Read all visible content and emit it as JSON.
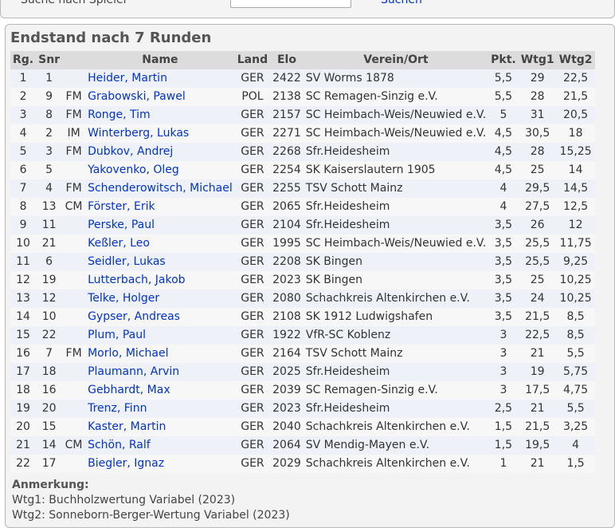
{
  "search": {
    "label": "Suche nach Spieler",
    "input_value": "",
    "button": "Suchen"
  },
  "standings": {
    "title": "Endstand nach 7 Runden",
    "headers": [
      "Rg.",
      "Snr",
      "",
      "Name",
      "Land",
      "Elo",
      "Verein/Ort",
      "Pkt.",
      "Wtg1",
      "Wtg2"
    ],
    "rows": [
      [
        "1",
        "1",
        "",
        "Heider, Martin",
        "GER",
        "2422",
        "SV Worms 1878",
        "5,5",
        "29",
        "22,5"
      ],
      [
        "2",
        "9",
        "FM",
        "Grabowski, Pawel",
        "POL",
        "2138",
        "SC Remagen-Sinzig e.V.",
        "5,5",
        "28",
        "21,5"
      ],
      [
        "3",
        "8",
        "FM",
        "Ronge, Tim",
        "GER",
        "2157",
        "SC Heimbach-Weis/Neuwied e.V.",
        "5",
        "31",
        "20,5"
      ],
      [
        "4",
        "2",
        "IM",
        "Winterberg, Lukas",
        "GER",
        "2271",
        "SC Heimbach-Weis/Neuwied e.V.",
        "4,5",
        "30,5",
        "18"
      ],
      [
        "5",
        "3",
        "FM",
        "Dubkov, Andrej",
        "GER",
        "2268",
        "Sfr.Heidesheim",
        "4,5",
        "28",
        "15,25"
      ],
      [
        "6",
        "5",
        "",
        "Yakovenko, Oleg",
        "GER",
        "2254",
        "SK Kaiserslautern 1905",
        "4,5",
        "25",
        "14"
      ],
      [
        "7",
        "4",
        "FM",
        "Schenderowitsch, Michael",
        "GER",
        "2255",
        "TSV Schott Mainz",
        "4",
        "29,5",
        "14,5"
      ],
      [
        "8",
        "13",
        "CM",
        "Förster, Erik",
        "GER",
        "2065",
        "Sfr.Heidesheim",
        "4",
        "27,5",
        "12,5"
      ],
      [
        "9",
        "11",
        "",
        "Perske, Paul",
        "GER",
        "2104",
        "Sfr.Heidesheim",
        "3,5",
        "26",
        "12"
      ],
      [
        "10",
        "21",
        "",
        "Keßler, Leo",
        "GER",
        "1995",
        "SC Heimbach-Weis/Neuwied e.V.",
        "3,5",
        "25,5",
        "11,75"
      ],
      [
        "11",
        "6",
        "",
        "Seidler, Lukas",
        "GER",
        "2208",
        "SK Bingen",
        "3,5",
        "25,5",
        "9,25"
      ],
      [
        "12",
        "19",
        "",
        "Lutterbach, Jakob",
        "GER",
        "2023",
        "SK Bingen",
        "3,5",
        "25",
        "10,25"
      ],
      [
        "13",
        "12",
        "",
        "Telke, Holger",
        "GER",
        "2080",
        "Schachkreis Altenkirchen e.V.",
        "3,5",
        "24",
        "10,25"
      ],
      [
        "14",
        "10",
        "",
        "Gypser, Andreas",
        "GER",
        "2108",
        "SK 1912 Ludwigshafen",
        "3,5",
        "21,5",
        "8,5"
      ],
      [
        "15",
        "22",
        "",
        "Plum, Paul",
        "GER",
        "1922",
        "VfR-SC Koblenz",
        "3",
        "22,5",
        "8,5"
      ],
      [
        "16",
        "7",
        "FM",
        "Morlo, Michael",
        "GER",
        "2164",
        "TSV Schott Mainz",
        "3",
        "21",
        "5,5"
      ],
      [
        "17",
        "18",
        "",
        "Plaumann, Arvin",
        "GER",
        "2025",
        "Sfr.Heidesheim",
        "3",
        "19",
        "5,75"
      ],
      [
        "18",
        "16",
        "",
        "Gebhardt, Max",
        "GER",
        "2039",
        "SC Remagen-Sinzig e.V.",
        "3",
        "17,5",
        "4,75"
      ],
      [
        "19",
        "20",
        "",
        "Trenz, Finn",
        "GER",
        "2023",
        "Sfr.Heidesheim",
        "2,5",
        "21",
        "5,5"
      ],
      [
        "20",
        "15",
        "",
        "Kaster, Martin",
        "GER",
        "2040",
        "Schachkreis Altenkirchen e.V.",
        "1,5",
        "21,5",
        "3,25"
      ],
      [
        "21",
        "14",
        "CM",
        "Schön, Ralf",
        "GER",
        "2064",
        "SV Mendig-Mayen e.V.",
        "1,5",
        "19,5",
        "4"
      ],
      [
        "22",
        "17",
        "",
        "Biegler, Ignaz",
        "GER",
        "2029",
        "Schachkreis Altenkirchen e.V.",
        "1",
        "21",
        "1,5"
      ]
    ]
  },
  "remarks": {
    "title": "Anmerkung:",
    "lines": [
      "Wtg1: Buchholzwertung Variabel (2023)",
      "Wtg2: Sonneborn-Berger-Wertung Variabel (2023)"
    ]
  }
}
